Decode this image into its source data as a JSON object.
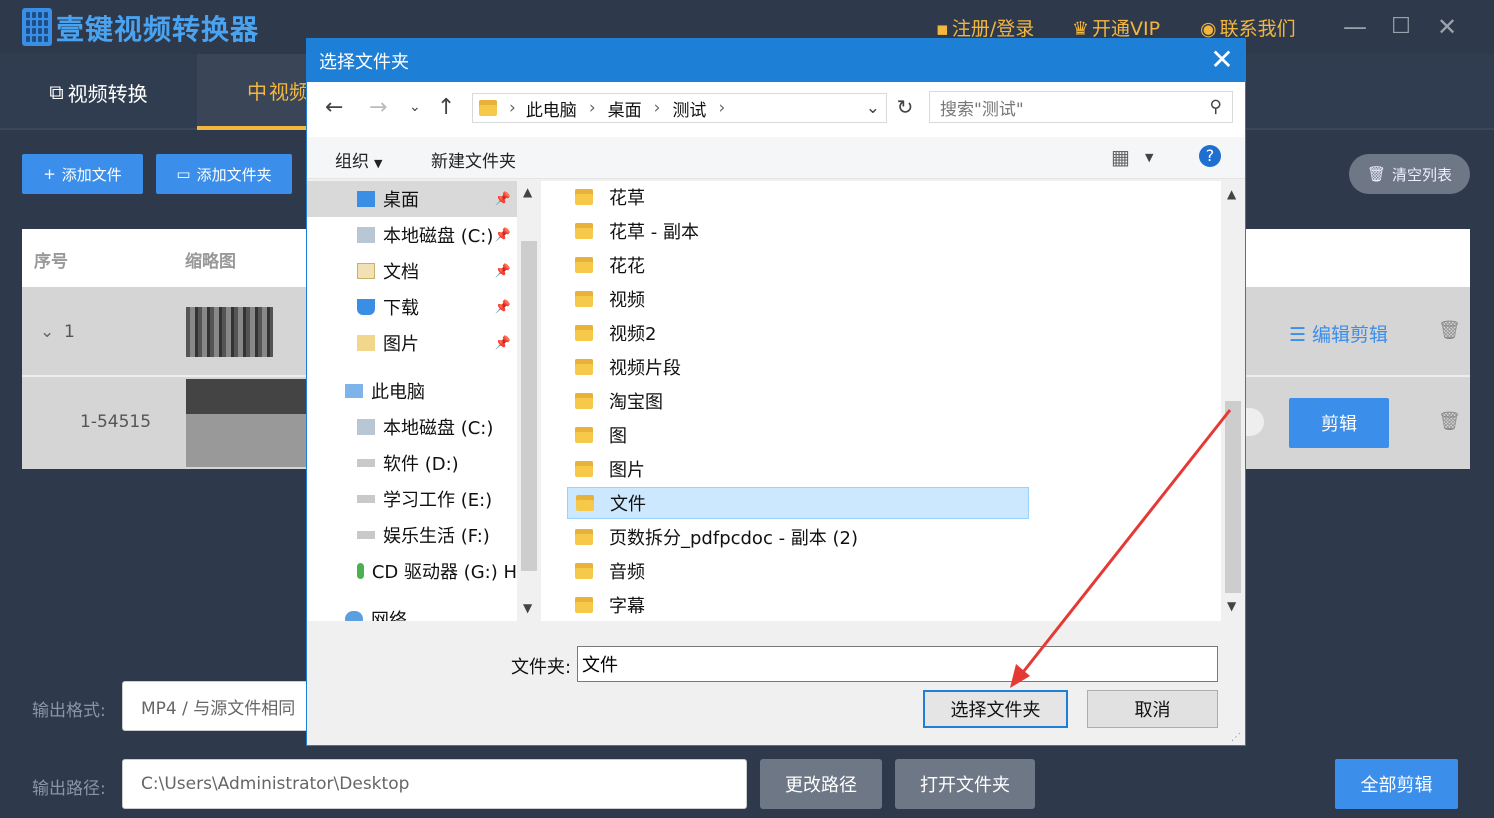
{
  "app": {
    "title": "壹键视频转换器",
    "header_links": {
      "register": "注册/登录",
      "vip": "开通VIP",
      "contact": "联系我们"
    }
  },
  "tabs": {
    "convert": "视频转换",
    "clip": "视频"
  },
  "toolbar": {
    "add_file": "添加文件",
    "add_folder": "添加文件夹",
    "clear_list": "清空列表"
  },
  "table": {
    "headers": {
      "index": "序号",
      "thumbnail": "缩略图"
    },
    "rows": [
      {
        "index": "1",
        "action": "编辑剪辑"
      },
      {
        "index": "1-54515",
        "action": "剪辑"
      }
    ]
  },
  "bottom": {
    "format_label": "输出格式:",
    "format_value": "MP4 / 与源文件相同",
    "path_label": "输出路径:",
    "path_value": "C:\\Users\\Administrator\\Desktop",
    "change_path": "更改路径",
    "open_folder": "打开文件夹",
    "clip_all": "全部剪辑"
  },
  "dialog": {
    "title": "选择文件夹",
    "breadcrumb": [
      "此电脑",
      "桌面",
      "测试"
    ],
    "search_placeholder": "搜索\"测试\"",
    "organize": "组织",
    "new_folder": "新建文件夹",
    "nav_items": [
      {
        "label": "桌面",
        "icon": "desktop-icon",
        "pinned": true
      },
      {
        "label": "本地磁盘 (C:)",
        "icon": "drive-icon",
        "pinned": true
      },
      {
        "label": "文档",
        "icon": "document-icon",
        "pinned": true
      },
      {
        "label": "下载",
        "icon": "download-icon",
        "pinned": true
      },
      {
        "label": "图片",
        "icon": "pictures-icon",
        "pinned": true
      },
      {
        "label": "此电脑",
        "icon": "computer-icon",
        "pinned": false
      },
      {
        "label": "本地磁盘 (C:)",
        "icon": "drive-icon",
        "pinned": false
      },
      {
        "label": "软件 (D:)",
        "icon": "drive-icon",
        "pinned": false
      },
      {
        "label": "学习工作 (E:)",
        "icon": "drive-icon",
        "pinned": false
      },
      {
        "label": "娱乐生活 (F:)",
        "icon": "drive-icon",
        "pinned": false
      },
      {
        "label": "CD 驱动器 (G:) H",
        "icon": "cd-icon",
        "pinned": false
      },
      {
        "label": "网络",
        "icon": "network-icon",
        "pinned": false
      }
    ],
    "folders": [
      "花草",
      "花草 - 副本",
      "花花",
      "视频",
      "视频2",
      "视频片段",
      "淘宝图",
      "图",
      "图片",
      "文件",
      "页数拆分_pdfpcdoc - 副本 (2)",
      "音频",
      "字幕"
    ],
    "selected_folder": "文件",
    "folder_label": "文件夹:",
    "folder_value": "文件",
    "select_button": "选择文件夹",
    "cancel_button": "取消"
  },
  "colors": {
    "accent": "#3b8eea",
    "gold": "#f3b63e",
    "dialog_blue": "#1e7fd6",
    "annotation_red": "#e53935"
  }
}
